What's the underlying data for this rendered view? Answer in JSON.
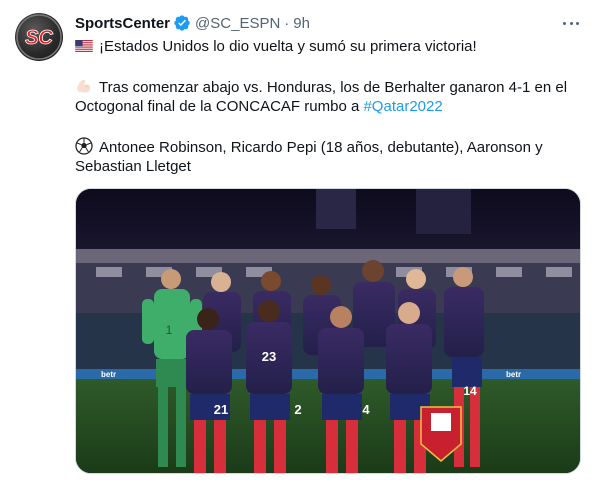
{
  "tweet": {
    "author": {
      "display_name": "SportsCenter",
      "handle": "@SC_ESPN",
      "separator": "·",
      "time": "9h",
      "avatar_text": "SC"
    },
    "text": {
      "line1": "¡Estados Unidos lo dio vuelta y sumó su primera victoria!",
      "line2": "Tras comenzar abajo vs. Honduras, los de Berhalter ganaron 4-1 en el",
      "line3_prefix": "Octogonal final de la CONCACAF rumbo a ",
      "hashtag": "#Qatar2022",
      "line4": "Antonee Robinson, Ricardo Pepi (18 años, debutante), Aaronson y",
      "line5": "Sebastian Lletget"
    },
    "media": {
      "alt_icons": [
        "team-photo"
      ],
      "jersey_numbers": [
        "1",
        "23",
        "2",
        "4",
        "14",
        "21",
        "2"
      ],
      "banner_text": "betr"
    },
    "icons": {
      "verified": "verified-badge-icon",
      "more": "more-options-icon",
      "flag": "us-flag-icon",
      "muscle": "flexed-biceps-icon",
      "ball": "soccer-ball-icon"
    },
    "colors": {
      "link": "#1d9bf0",
      "secondary_text": "#536471",
      "verified": "#1d9bf0"
    }
  }
}
